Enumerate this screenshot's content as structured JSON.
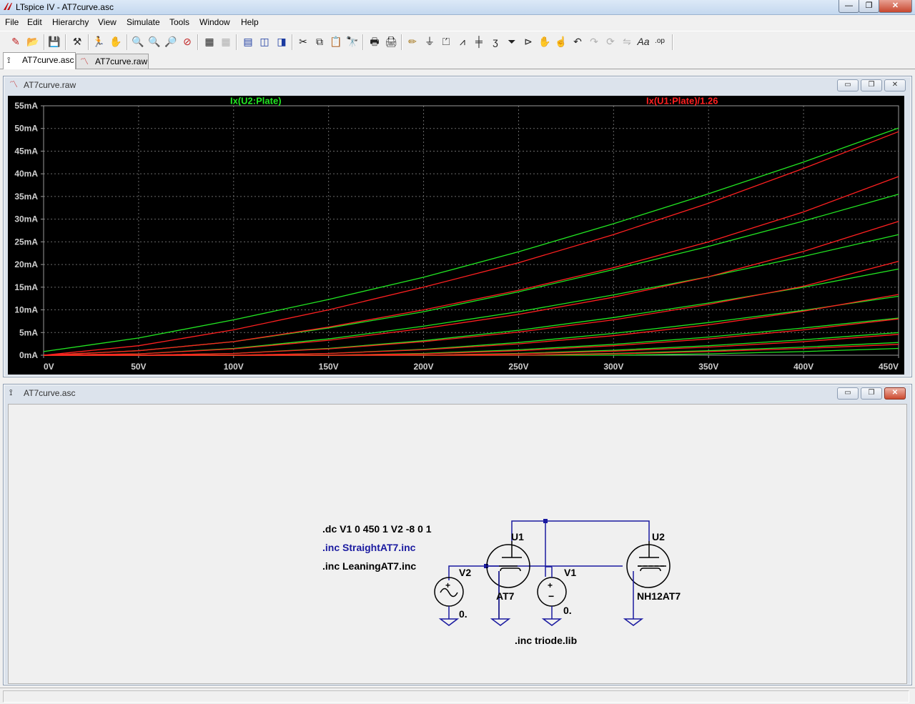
{
  "window": {
    "title": "LTspice IV - AT7curve.asc",
    "minimize": "—",
    "restore": "❐",
    "close": "✕"
  },
  "menu": [
    "File",
    "Edit",
    "Hierarchy",
    "View",
    "Simulate",
    "Tools",
    "Window",
    "Help"
  ],
  "toolbar_icons": [
    "new-schematic-icon",
    "open-icon",
    "save-icon",
    "control-panel-icon",
    "run-icon",
    "halt-icon",
    "zoom-in-icon",
    "zoom-out-icon",
    "zoom-full-icon",
    "zoom-cancel-icon",
    "autorange-icon",
    "grid-icon",
    "tile-horizontal-icon",
    "cascade-icon",
    "tile-vertical-icon",
    "cut-icon",
    "copy-icon",
    "paste-icon",
    "find-icon",
    "print-setup-icon",
    "print-icon",
    "wire-icon",
    "ground-icon",
    "label-net-icon",
    "resistor-icon",
    "capacitor-icon",
    "inductor-icon",
    "diode-icon",
    "component-icon",
    "move-icon",
    "drag-icon",
    "undo-icon",
    "redo-icon",
    "rotate-icon",
    "mirror-icon",
    "text-icon",
    "spice-directive-icon"
  ],
  "tabs": [
    {
      "label": "AT7curve.asc",
      "icon": "schematic-icon",
      "active": true
    },
    {
      "label": "AT7curve.raw",
      "icon": "waveform-icon",
      "active": false
    }
  ],
  "waveform_window": {
    "title": "AT7curve.raw",
    "buttons": {
      "minimize": "▭",
      "restore": "❐",
      "close": "✕"
    }
  },
  "schematic_window": {
    "title": "AT7curve.asc",
    "buttons": {
      "minimize": "▭",
      "restore": "❐",
      "close": "✕"
    }
  },
  "chart_data": {
    "type": "line",
    "xlabel": "",
    "ylabel": "",
    "xlim": [
      0,
      450
    ],
    "ylim": [
      0,
      55
    ],
    "x_ticks": [
      "0V",
      "50V",
      "100V",
      "150V",
      "200V",
      "250V",
      "300V",
      "350V",
      "400V",
      "450V"
    ],
    "y_ticks": [
      "0mA",
      "5mA",
      "10mA",
      "15mA",
      "20mA",
      "25mA",
      "30mA",
      "35mA",
      "40mA",
      "45mA",
      "50mA",
      "55mA"
    ],
    "grid": true,
    "background": "#000000",
    "legend": [
      {
        "name": "Ix(U2:Plate)",
        "color": "#22e622"
      },
      {
        "name": "Ix(U1:Plate)/1.26",
        "color": "#ff2020"
      }
    ],
    "x": [
      0,
      50,
      100,
      150,
      200,
      250,
      300,
      350,
      400,
      450
    ],
    "series": [
      {
        "name": "Ix(U2:Plate)",
        "color": "#22e622",
        "values": [
          0.8,
          3.8,
          7.8,
          12.3,
          17.2,
          22.8,
          29.0,
          35.6,
          42.6,
          50.1
        ]
      },
      {
        "name": "Ix(U2:Plate)",
        "color": "#22e622",
        "values": [
          0,
          1.0,
          3.0,
          6.0,
          9.6,
          14.0,
          18.9,
          24.0,
          29.6,
          35.5
        ]
      },
      {
        "name": "Ix(U2:Plate)",
        "color": "#22e622",
        "values": [
          0,
          0.3,
          1.5,
          3.6,
          6.4,
          9.6,
          13.3,
          17.3,
          21.8,
          26.6
        ]
      },
      {
        "name": "Ix(U2:Plate)",
        "color": "#22e622",
        "values": [
          0,
          0,
          0.4,
          1.5,
          3.2,
          5.5,
          8.3,
          11.5,
          15.0,
          19.0
        ]
      },
      {
        "name": "Ix(U2:Plate)",
        "color": "#22e622",
        "values": [
          0,
          0,
          0,
          0.4,
          1.3,
          2.8,
          4.8,
          7.2,
          9.9,
          13.0
        ]
      },
      {
        "name": "Ix(U2:Plate)",
        "color": "#22e622",
        "values": [
          0,
          0,
          0,
          0,
          0.4,
          1.2,
          2.4,
          4.0,
          6.0,
          8.2
        ]
      },
      {
        "name": "Ix(U2:Plate)",
        "color": "#22e622",
        "values": [
          0,
          0,
          0,
          0,
          0,
          0.4,
          1.1,
          2.1,
          3.4,
          5.0
        ]
      },
      {
        "name": "Ix(U2:Plate)",
        "color": "#22e622",
        "values": [
          0,
          0,
          0,
          0,
          0,
          0,
          0.4,
          1.0,
          1.8,
          2.8
        ]
      },
      {
        "name": "Ix(U2:Plate)",
        "color": "#22e622",
        "values": [
          0,
          0,
          0,
          0,
          0,
          0,
          0,
          0.3,
          0.8,
          1.5
        ]
      },
      {
        "name": "Ix(U1:Plate)/1.26",
        "color": "#ff2020",
        "values": [
          0,
          2.1,
          5.6,
          10.0,
          15.0,
          20.4,
          26.6,
          33.5,
          41.2,
          49.3
        ]
      },
      {
        "name": "Ix(U1:Plate)/1.26",
        "color": "#ff2020",
        "values": [
          0,
          1.0,
          3.0,
          6.2,
          10.0,
          14.3,
          19.3,
          25.0,
          31.6,
          39.4
        ]
      },
      {
        "name": "Ix(U1:Plate)/1.26",
        "color": "#ff2020",
        "values": [
          0,
          0.3,
          1.4,
          3.3,
          5.9,
          9.0,
          12.8,
          17.3,
          22.9,
          29.5
        ]
      },
      {
        "name": "Ix(U1:Plate)/1.26",
        "color": "#ff2020",
        "values": [
          0,
          0,
          0.4,
          1.4,
          3.0,
          5.1,
          7.8,
          11.2,
          15.2,
          20.7
        ]
      },
      {
        "name": "Ix(U1:Plate)/1.26",
        "color": "#ff2020",
        "values": [
          0,
          0,
          0,
          0.4,
          1.2,
          2.5,
          4.3,
          6.7,
          9.7,
          13.4
        ]
      },
      {
        "name": "Ix(U1:Plate)/1.26",
        "color": "#ff2020",
        "values": [
          0,
          0,
          0,
          0,
          0.3,
          1.0,
          2.1,
          3.6,
          5.6,
          8.0
        ]
      },
      {
        "name": "Ix(U1:Plate)/1.26",
        "color": "#ff2020",
        "values": [
          0,
          0,
          0,
          0,
          0,
          0.3,
          0.9,
          1.8,
          3.0,
          4.6
        ]
      },
      {
        "name": "Ix(U1:Plate)/1.26",
        "color": "#ff2020",
        "values": [
          0,
          0,
          0,
          0,
          0,
          0,
          0.3,
          0.8,
          1.5,
          2.4
        ]
      }
    ]
  },
  "schematic": {
    "directives": [
      {
        "text": ".dc V1 0 450 1 V2 -8 0 1",
        "color": "#000000"
      },
      {
        "text": ".inc StraightAT7.inc",
        "color": "#1a1aa0"
      },
      {
        "text": ".inc LeaningAT7.inc",
        "color": "#000000"
      }
    ],
    "lib_directive": ".inc triode.lib",
    "components": [
      {
        "ref": "U1",
        "value": "AT7"
      },
      {
        "ref": "U2",
        "value": "NH12AT7"
      },
      {
        "ref": "V1",
        "value": "0."
      },
      {
        "ref": "V2",
        "value": "0."
      }
    ],
    "wire_color": "#1a1aa0"
  }
}
